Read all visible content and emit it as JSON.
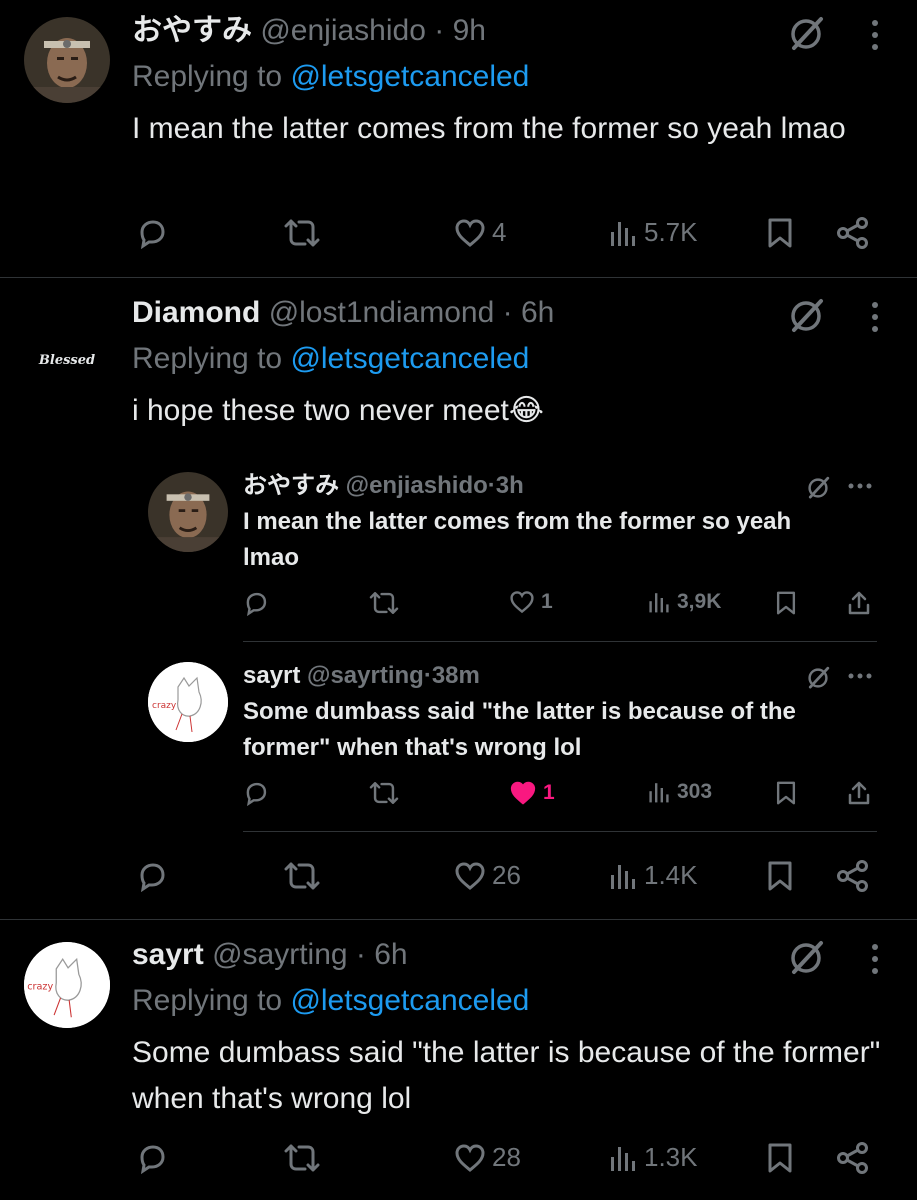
{
  "tweets": [
    {
      "name": "おやすみ",
      "handle": "@enjiashido",
      "sep": "·",
      "time": "9h",
      "replying_prefix": "Replying to ",
      "replying_to": "@letsgetcanceled",
      "text": "I mean the latter comes from the former so yeah lmao",
      "likes": "4",
      "views": "5.7K"
    },
    {
      "name": "Diamond",
      "handle": "@lost1ndiamond",
      "sep": "·",
      "time": "6h",
      "avatar_text": "Blessed",
      "replying_prefix": "Replying to ",
      "replying_to": "@letsgetcanceled",
      "text": "i hope these two never meet😂",
      "likes": "26",
      "views": "1.4K"
    },
    {
      "name": "sayrt",
      "handle": "@sayrting",
      "sep": "·",
      "time": "6h",
      "avatar_text": "crazy",
      "replying_prefix": "Replying to ",
      "replying_to": "@letsgetcanceled",
      "text": "Some dumbass said \"the latter is because of the former\" when that's wrong lol",
      "likes": "28",
      "views": "1.3K"
    }
  ],
  "quoted": [
    {
      "name": "おやすみ",
      "handle": "@enjiashido",
      "sep": "·",
      "time": "3h",
      "text": "I mean the latter comes from the former so yeah lmao",
      "likes": "1",
      "views": "3,9K",
      "liked": false
    },
    {
      "name": "sayrt",
      "handle": "@sayrting",
      "sep": "·",
      "time": "38m",
      "avatar_text": "crazy",
      "text": "Some dumbass said \"the latter is because of the former\" when that's wrong lol",
      "likes": "1",
      "views": "303",
      "liked": true
    }
  ],
  "colors": {
    "background": "#000000",
    "text": "#e7e9ea",
    "secondary": "#71767b",
    "link": "#1d9bf0",
    "like_active": "#f91880",
    "divider": "#2f3336"
  },
  "icons": [
    "reply-icon",
    "retweet-icon",
    "heart-icon",
    "views-icon",
    "bookmark-icon",
    "share-icon",
    "grok-icon",
    "more-icon"
  ]
}
